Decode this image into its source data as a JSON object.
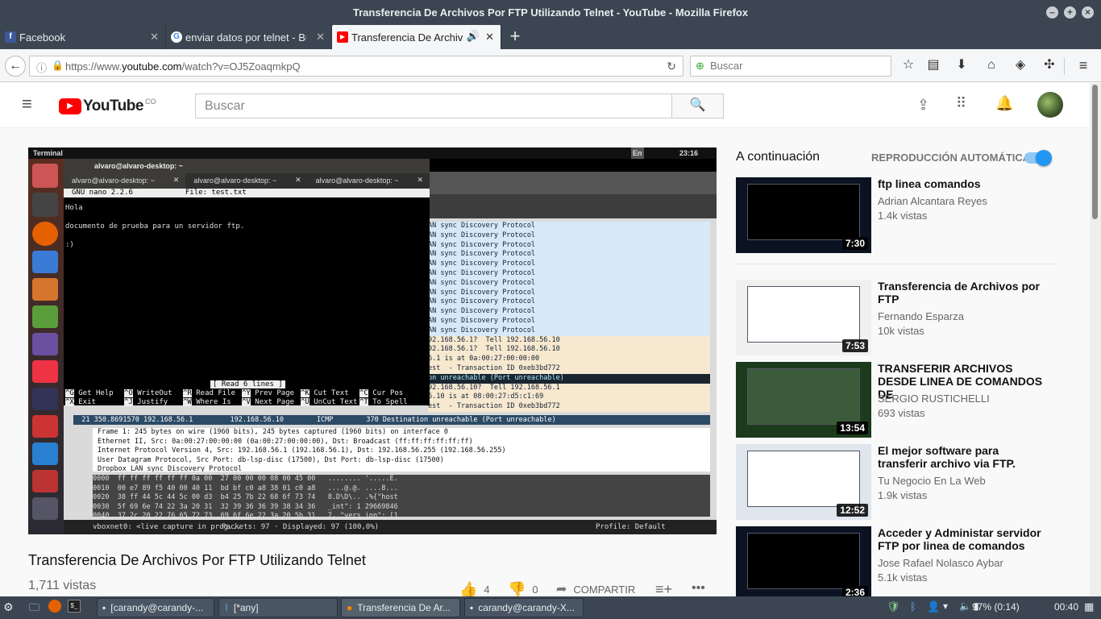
{
  "window": {
    "title": "Transferencia De Archivos Por FTP Utilizando Telnet - YouTube - Mozilla Firefox"
  },
  "tabs": [
    {
      "label": "Facebook",
      "favicon": "facebook-icon"
    },
    {
      "label": "enviar datos por telnet - Bu",
      "favicon": "google-icon"
    },
    {
      "label": "Transferencia De Archiv",
      "favicon": "youtube-icon"
    }
  ],
  "nav": {
    "url_prefix": "https://www.",
    "url_domain": "youtube.com",
    "url_path": "/watch?v=OJ5ZoaqmkpQ",
    "search_placeholder": "Buscar"
  },
  "youtube": {
    "logo": "YouTube",
    "region": "CO",
    "search_placeholder": "Buscar"
  },
  "video": {
    "title": "Transferencia De Archivos Por FTP Utilizando Telnet",
    "views": "1,711 vistas",
    "likes": "4",
    "dislikes": "0",
    "share": "COMPARTIR",
    "screen": {
      "topbar_label": "Terminal",
      "clock": "23:16",
      "tray_lang": "En",
      "term_title": "alvaro@alvaro-desktop: ~",
      "term_tabs": [
        "alvaro@alvaro-desktop: ~",
        "alvaro@alvaro-desktop: ~",
        "alvaro@alvaro-desktop: ~"
      ],
      "nano_header_left": "GNU nano 2.2.6",
      "nano_header_file": "File: test.txt",
      "nano_lines": [
        "Hola",
        "",
        "documento de prueba para un servidor ftp.",
        "",
        ":)"
      ],
      "nano_status": "[ Read 6 lines ]",
      "nano_help1": [
        [
          "^G",
          "Get Help"
        ],
        [
          "^O",
          "WriteOut"
        ],
        [
          "^R",
          "Read File"
        ],
        [
          "^Y",
          "Prev Page"
        ],
        [
          "^K",
          "Cut Text"
        ],
        [
          "^C",
          "Cur Pos"
        ]
      ],
      "nano_help2": [
        [
          "^X",
          "Exit"
        ],
        [
          "^J",
          "Justify"
        ],
        [
          "^W",
          "Where Is"
        ],
        [
          "^V",
          "Next Page"
        ],
        [
          "^U",
          "UnCut Text"
        ],
        [
          "^T",
          "To Spell"
        ]
      ],
      "ws_rows": [
        "AN sync Discovery Protocol",
        "AN sync Discovery Protocol",
        "AN sync Discovery Protocol",
        "AN sync Discovery Protocol",
        "AN sync Discovery Protocol",
        "AN sync Discovery Protocol",
        "AN sync Discovery Protocol",
        "AN sync Discovery Protocol",
        "AN sync Discovery Protocol",
        "AN sync Discovery Protocol",
        "AN sync Discovery Protocol",
        "AN sync Discovery Protocol",
        "92.168.56.1?  Tell 192.168.56.10",
        "92.168.56.1?  Tell 192.168.56.10",
        "6.1 is at 0a:00:27:00:00:00",
        "est  - Transaction ID 0xeb3bd772",
        "on unreachable (Port unreachable)",
        "92.168.56.10?  Tell 192.168.56.1",
        "6.10 is at 08:00:27:d5:c1:69",
        "est  - Transaction ID 0xeb3bd772"
      ],
      "ws_selected": "  21 350.8691570 192.168.56.1         192.168.56.10        ICMP        370 Destination unreachable (Port unreachable)",
      "ws_details": [
        "Frame 1: 245 bytes on wire (1960 bits), 245 bytes captured (1960 bits) on interface 0",
        "Ethernet II, Src: 0a:00:27:00:00:00 (0a:00:27:00:00:00), Dst: Broadcast (ff:ff:ff:ff:ff:ff)",
        "Internet Protocol Version 4, Src: 192.168.56.1 (192.168.56.1), Dst: 192.168.56.255 (192.168.56.255)",
        "User Datagram Protocol, Src Port: db-lsp-disc (17500), Dst Port: db-lsp-disc (17500)",
        "Dropbox LAN sync Discovery Protocol"
      ],
      "ws_hex": [
        "0000  ff ff ff ff ff ff 0a 00  27 00 00 00 08 00 45 00   ........ '.....E.",
        "0010  00 e7 89 f5 40 00 40 11  bd bf c0 a8 38 01 c0 a8   ....@.@. ....8...",
        "0020  38 ff 44 5c 44 5c 00 d3  b4 25 7b 22 68 6f 73 74   8.D\\D\\.. .%{\"host",
        "0030  5f 69 6e 74 22 3a 20 31  32 39 36 36 39 38 34 36   _int\": 1 29669846",
        "0040  37 2c 20 22 76 65 72 73  69 6f 6e 22 3a 20 5b 31   7, \"vers ion\": [1"
      ],
      "ws_status_left": "vboxnet0: <live capture in prog...",
      "ws_status_mid": "Packets: 97 · Displayed: 97 (100,0%)",
      "ws_status_right": "Profile: Default"
    }
  },
  "sidebar": {
    "up_next": "A continuación",
    "autoplay": "REPRODUCCIÓN AUTOMÁTICA",
    "autoplay_on": true,
    "items": [
      {
        "title": "ftp linea comandos",
        "channel": "Adrian Alcantara Reyes",
        "views": "1.4k vistas",
        "duration": "7:30"
      },
      {
        "title": "Transferencia de Archivos por FTP",
        "channel": "Fernando Esparza",
        "views": "10k vistas",
        "duration": "7:53"
      },
      {
        "title": "TRANSFERIR ARCHIVOS DESDE LINEA DE COMANDOS DE",
        "channel": "SERGIO RUSTICHELLI",
        "views": "693 vistas",
        "duration": "13:54"
      },
      {
        "title": "El mejor software para transferir archivo via FTP.",
        "channel": "Tu Negocio En La Web",
        "views": "1.9k vistas",
        "duration": "12:52"
      },
      {
        "title": "Acceder y Administar servidor FTP por linea de comandos",
        "channel": "Jose Rafael Nolasco Aybar",
        "views": "5.1k vistas",
        "duration": "2:36"
      }
    ]
  },
  "taskbar": {
    "items": [
      "[carandy@carandy-...",
      "[*any]",
      "Transferencia De Ar...",
      "carandy@carandy-X..."
    ],
    "battery": "97% (0:14)",
    "clock": "00:40"
  },
  "colors": {
    "youtube_red": "#ff0000",
    "autoplay_blue": "#2196f3",
    "chrome_dark": "#3b4652"
  }
}
